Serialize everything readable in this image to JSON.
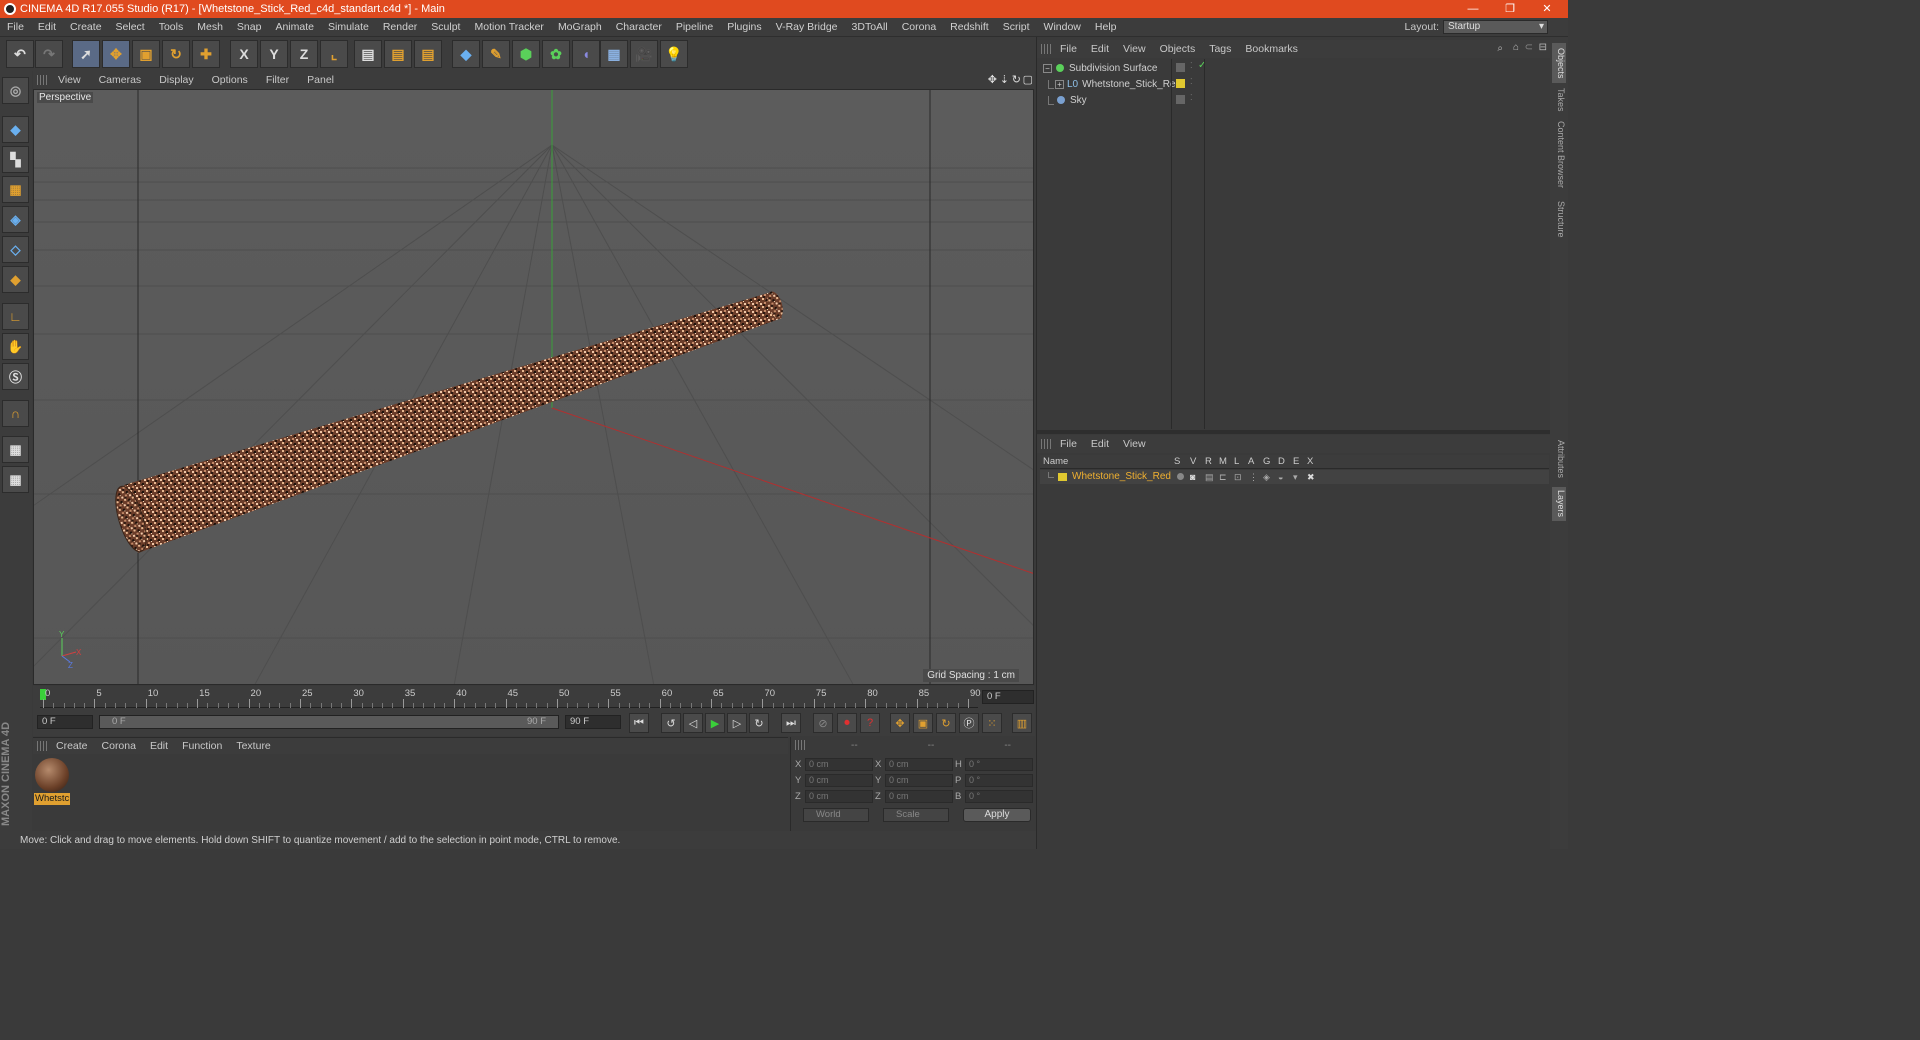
{
  "window": {
    "title": "CINEMA 4D R17.055 Studio (R17) - [Whetstone_Stick_Red_c4d_standart.c4d *] - Main",
    "minimize": "—",
    "restore": "❐",
    "close": "✕"
  },
  "menubar": [
    "File",
    "Edit",
    "Create",
    "Select",
    "Tools",
    "Mesh",
    "Snap",
    "Animate",
    "Simulate",
    "Render",
    "Sculpt",
    "Motion Tracker",
    "MoGraph",
    "Character",
    "Pipeline",
    "Plugins",
    "V-Ray Bridge",
    "3DToAll",
    "Corona",
    "Redshift",
    "Script",
    "Window",
    "Help"
  ],
  "layout": {
    "label": "Layout:",
    "value": "Startup"
  },
  "toolbar": {
    "axis_x": "X",
    "axis_y": "Y",
    "axis_z": "Z"
  },
  "viewport": {
    "menu": [
      "View",
      "Cameras",
      "Display",
      "Options",
      "Filter",
      "Panel"
    ],
    "camera_label": "Perspective",
    "grid_spacing": "Grid Spacing : 1 cm"
  },
  "timeline": {
    "ticks": [
      "0",
      "5",
      "10",
      "15",
      "20",
      "25",
      "30",
      "35",
      "40",
      "45",
      "50",
      "55",
      "60",
      "65",
      "70",
      "75",
      "80",
      "85",
      "90"
    ],
    "current_frame": "0 F"
  },
  "transport": {
    "start_field": "0 F",
    "range_start": "0 F",
    "range_end": "90 F",
    "end_field": "90 F"
  },
  "materials": {
    "menu": [
      "Create",
      "Corona",
      "Edit",
      "Function",
      "Texture"
    ],
    "items": [
      {
        "label": "Whetstc"
      }
    ]
  },
  "brand": "MAXON CINEMA 4D",
  "coordinates": {
    "headers": [
      "--",
      "--",
      "--"
    ],
    "rows": [
      {
        "a": "X",
        "av": "0 cm",
        "b": "X",
        "bv": "0 cm",
        "c": "H",
        "cv": "0 °"
      },
      {
        "a": "Y",
        "av": "0 cm",
        "b": "Y",
        "bv": "0 cm",
        "c": "P",
        "cv": "0 °"
      },
      {
        "a": "Z",
        "av": "0 cm",
        "b": "Z",
        "bv": "0 cm",
        "c": "B",
        "cv": "0 °"
      }
    ],
    "mode": "World",
    "transform": "Scale",
    "apply": "Apply"
  },
  "status": "Move: Click and drag to move elements. Hold down SHIFT to quantize movement / add to the selection in point mode, CTRL to remove.",
  "objects_panel": {
    "menu": [
      "File",
      "Edit",
      "View",
      "Objects",
      "Tags",
      "Bookmarks"
    ],
    "items": [
      {
        "name": "Subdivision Surface",
        "icon_color": "#5ad05a"
      },
      {
        "name": "Whetstone_Stick_Red",
        "icon_color": "#8ec0e8",
        "tag_color": "#e0c830"
      },
      {
        "name": "Sky",
        "icon_color": "#7aa0d0"
      }
    ]
  },
  "layers_panel": {
    "menu": [
      "File",
      "Edit",
      "View"
    ],
    "columns": [
      "Name",
      "S",
      "V",
      "R",
      "M",
      "L",
      "A",
      "G",
      "D",
      "E",
      "X"
    ],
    "rows": [
      {
        "name": "Whetstone_Stick_Red",
        "color": "#e0c830"
      }
    ]
  },
  "right_tabs": [
    "Objects",
    "Takes",
    "Content Browser",
    "Structure",
    "Attributes",
    "Layers"
  ],
  "colors": {
    "titlebar": "#e04a1f",
    "accent": "#e0a030",
    "layer_name": "#f0b030"
  }
}
